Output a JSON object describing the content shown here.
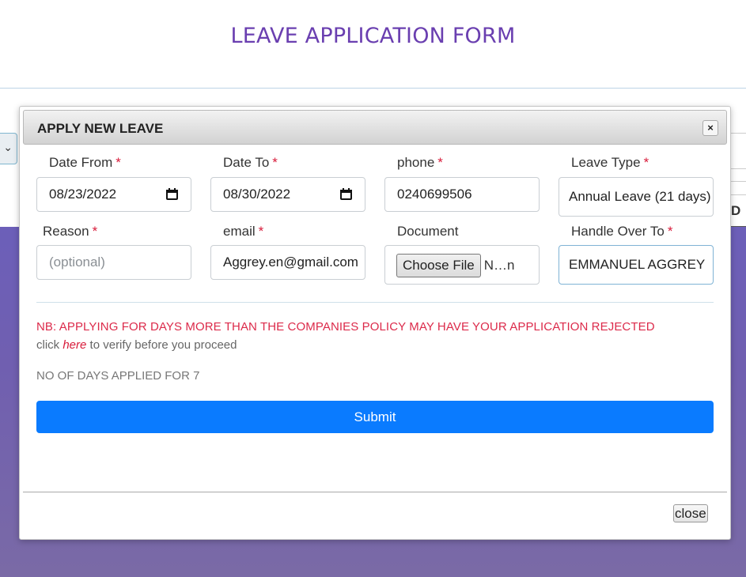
{
  "page": {
    "title": "LEAVE APPLICATION FORM"
  },
  "background": {
    "right_fragment": "D"
  },
  "modal": {
    "title": "APPLY NEW LEAVE",
    "close_icon": "×",
    "required_mark": "*",
    "fields": {
      "date_from": {
        "label": "Date From",
        "value": "08/23/2022"
      },
      "date_to": {
        "label": "Date To",
        "value": "08/30/2022"
      },
      "phone": {
        "label": "phone",
        "value": "0240699506"
      },
      "leave_type": {
        "label": "Leave Type",
        "value": "Annual Leave (21 days)"
      },
      "reason": {
        "label": "Reason",
        "placeholder": "(optional)"
      },
      "email": {
        "label": "email",
        "value": "Aggrey.en@gmail.com"
      },
      "document": {
        "label": "Document",
        "button": "Choose File",
        "file_text": "N…n"
      },
      "handle_over": {
        "label": "Handle Over To",
        "value": "EMMANUEL AGGREY"
      }
    },
    "notice": "NB: APPLYING FOR DAYS MORE THAN THE COMPANIES POLICY MAY HAVE YOUR APPLICATION REJECTED",
    "verify": {
      "prefix": "click",
      "link": "here",
      "suffix": "to verify before you proceed"
    },
    "days_applied": "NO OF DAYS APPLIED FOR 7",
    "submit_label": "Submit",
    "close_label": "close"
  },
  "colors": {
    "title": "#6a3fb0",
    "required": "#d81b3a",
    "submit": "#0a7bff",
    "background_gradient": "#6c5fb9"
  }
}
